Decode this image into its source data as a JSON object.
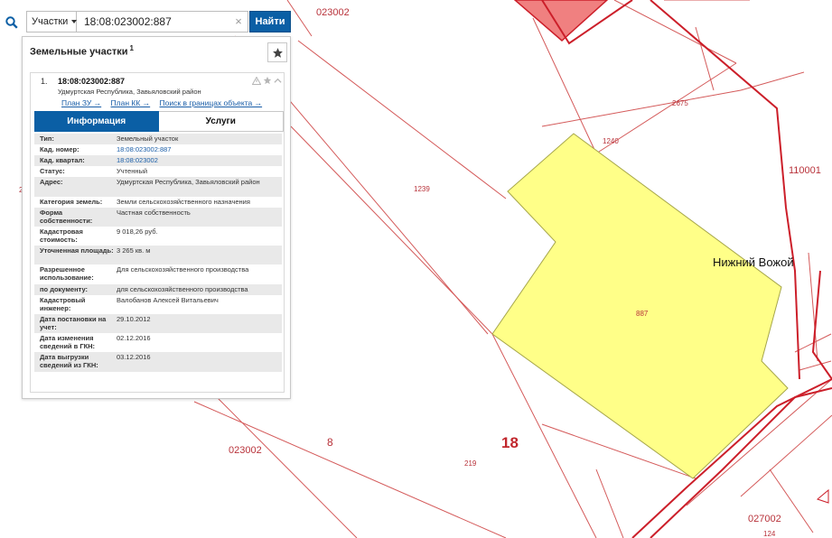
{
  "search": {
    "type_label": "Участки",
    "query": "18:08:023002:887",
    "clear_symbol": "×",
    "find_label": "Найти"
  },
  "panel": {
    "title": "Земельные участки",
    "count": "1",
    "item": {
      "index": "1.",
      "cad_number": "18:08:023002:887",
      "address": "Удмуртская Республика, Завьяловский район",
      "links": [
        "План ЗУ →",
        "План КК →",
        "Поиск в границах объекта →"
      ]
    },
    "tabs": [
      "Информация",
      "Услуги"
    ],
    "rows": [
      {
        "key": "Тип:",
        "value": "Земельный участок",
        "link": false
      },
      {
        "key": "Кад. номер:",
        "value": "18:08:023002:887",
        "link": true
      },
      {
        "key": "Кад. квартал:",
        "value": "18:08:023002",
        "link": true
      },
      {
        "key": "Статус:",
        "value": "Учтенный",
        "link": false
      },
      {
        "key": "Адрес:",
        "value": "Удмуртская Республика, Завьяловский район",
        "link": false
      },
      {
        "key": "Категория земель:",
        "value": "Земли сельскохозяйственного назначения",
        "link": false
      },
      {
        "key": "Форма собственности:",
        "value": "Частная собственность",
        "link": false
      },
      {
        "key": "Кадастровая стоимость:",
        "value": "9 018,26 руб.",
        "link": false
      },
      {
        "key": "Уточненная площадь:",
        "value": "3 265 кв. м",
        "link": false
      },
      {
        "key": "Разрешенное использование:",
        "value": "Для сельскохозяйственного производства",
        "link": false
      },
      {
        "key": "по документу:",
        "value": "для сельскохозяйственного производства",
        "link": false
      },
      {
        "key": "Кадастровый инженер:",
        "value": "Валобанов Алексей Витальевич",
        "link": false
      },
      {
        "key": "Дата постановки на учет:",
        "value": "29.10.2012",
        "link": false
      },
      {
        "key": "Дата изменения сведений в ГКН:",
        "value": "02.12.2016",
        "link": false
      },
      {
        "key": "Дата выгрузки сведений из ГКН:",
        "value": "03.12.2016",
        "link": false
      }
    ]
  },
  "map": {
    "labels": {
      "q023002_top": "023002",
      "q023002_bottom": "023002",
      "q110001": "110001",
      "q027002": "027002",
      "n2675": "2675",
      "n1240": "1240",
      "n1239": "1239",
      "n887": "887",
      "n219": "219",
      "n124": "124",
      "n8": "8",
      "n18": "18",
      "n2": "2",
      "place": "Нижний Вожой"
    },
    "colors": {
      "parcel_fill": "#ffff88",
      "parcel_stroke": "#a6a64a",
      "boundary": "#cc1f2a",
      "thin_line": "#d45a5a",
      "pink_parcel": "#f08080",
      "accent": "#0b5fa5"
    }
  }
}
